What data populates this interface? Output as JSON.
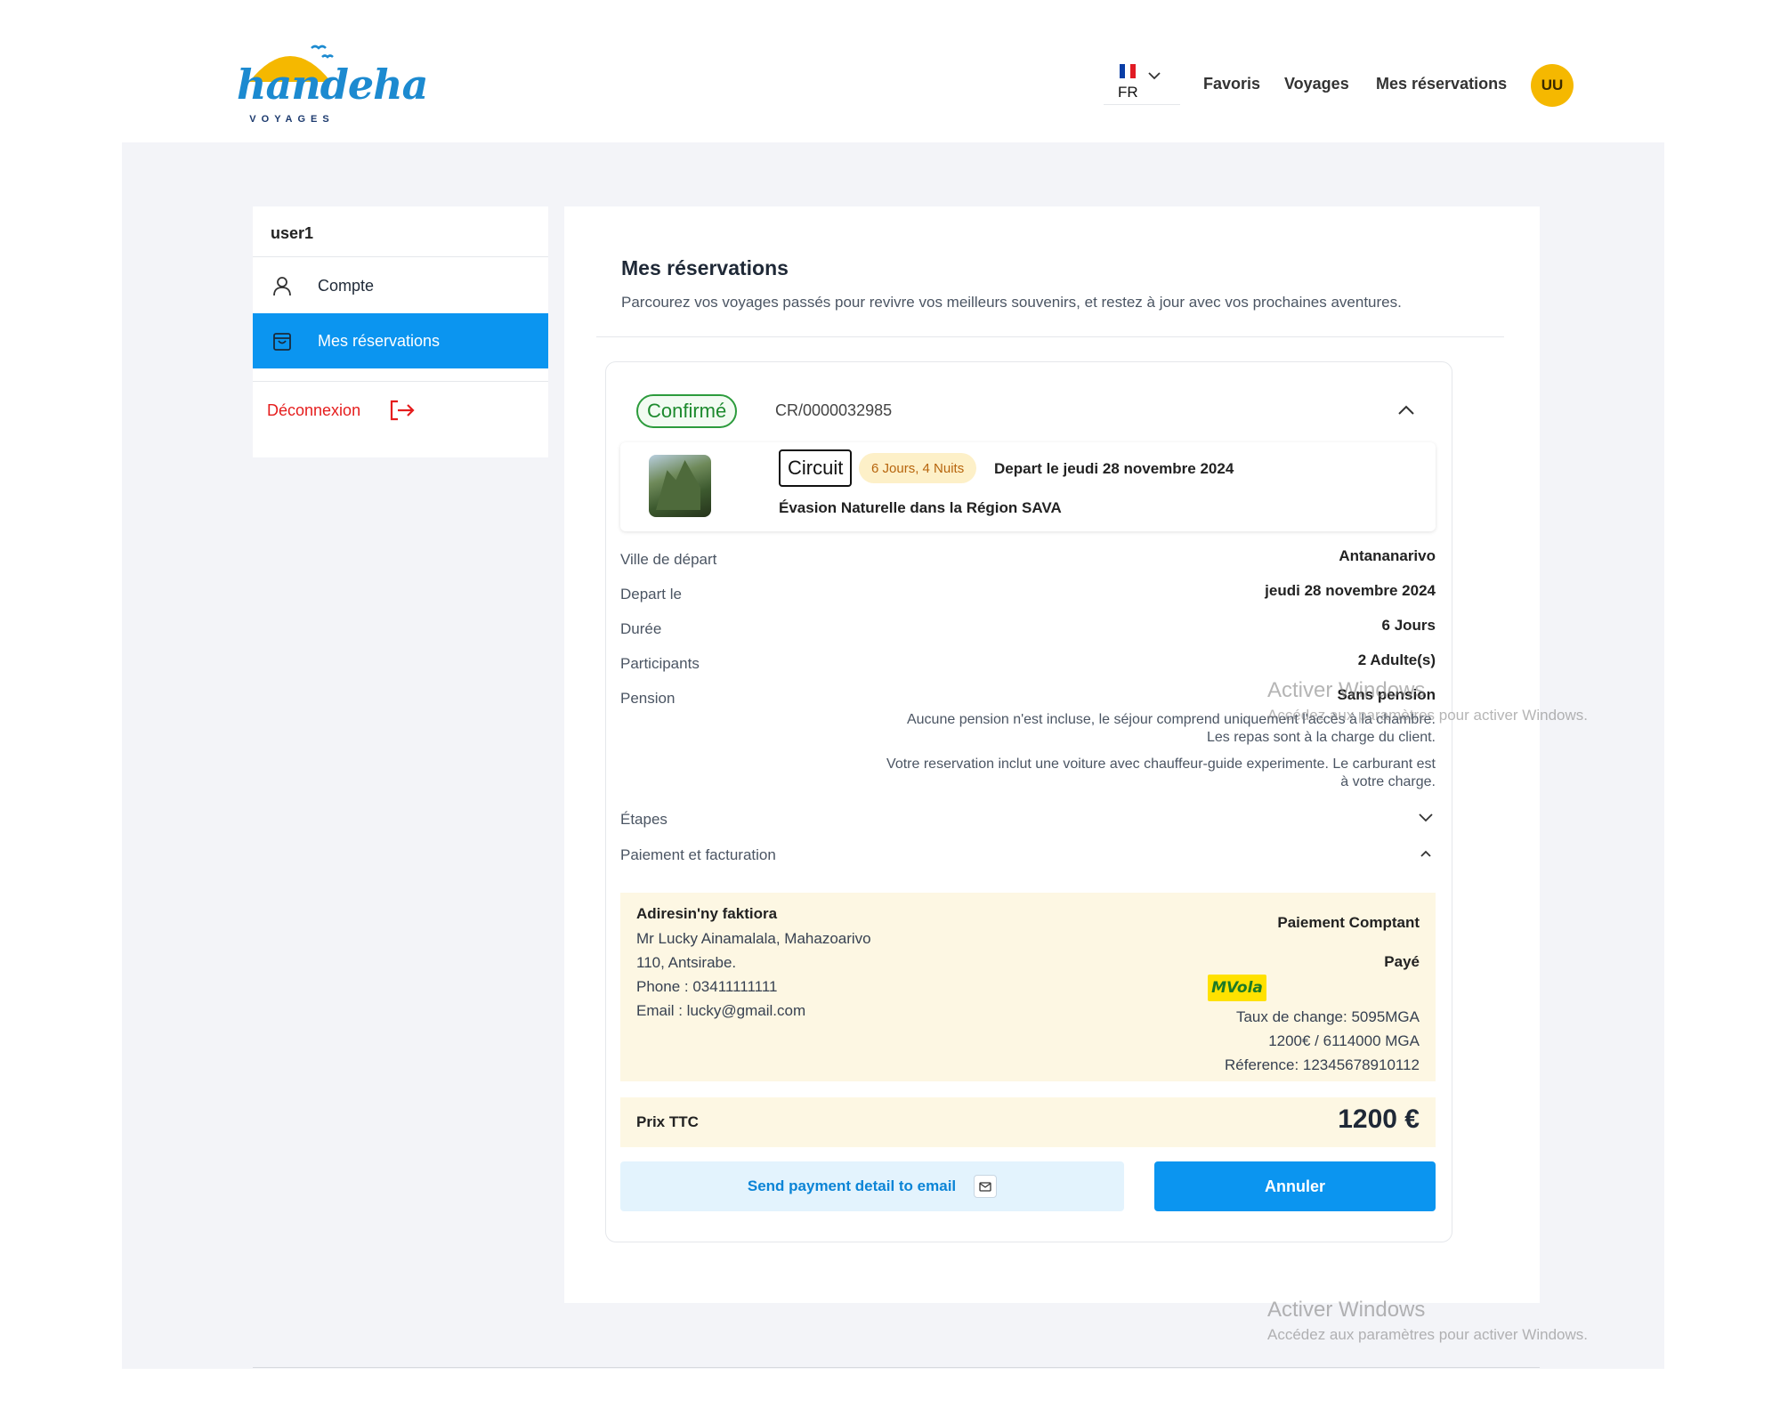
{
  "header": {
    "logo_text": "handeha",
    "logo_sub": "VOYAGES",
    "lang_code": "FR",
    "nav": [
      "Favoris",
      "Voyages",
      "Mes réservations"
    ],
    "avatar_initials": "UU"
  },
  "sidebar": {
    "username": "user1",
    "items": [
      {
        "label": "Compte",
        "icon": "user-icon"
      },
      {
        "label": "Mes réservations",
        "icon": "bag-icon"
      }
    ],
    "logout_label": "Déconnexion"
  },
  "main": {
    "title": "Mes réservations",
    "subtitle": "Parcourez vos voyages passés pour revivre vos meilleurs souvenirs, et restez à jour avec vos prochaines aventures."
  },
  "reservation": {
    "status": "Confirmé",
    "reference": "CR/0000032985",
    "type_tag": "Circuit",
    "duration_tag": "6 Jours, 4 Nuits",
    "depart_heading": "Depart le jeudi 28 novembre 2024",
    "trip_name": "Évasion Naturelle dans la Région SAVA",
    "details": [
      {
        "label": "Ville de départ",
        "value": "Antananarivo"
      },
      {
        "label": "Depart le",
        "value": "jeudi 28 novembre 2024"
      },
      {
        "label": "Durée",
        "value": "6 Jours"
      },
      {
        "label": "Participants",
        "value": "2 Adulte(s)"
      },
      {
        "label": "Pension",
        "value": "Sans pension"
      }
    ],
    "pension_note": [
      "Aucune pension n'est incluse, le séjour comprend uniquement l'accès à la chambre.",
      "Les repas sont à la charge du client."
    ],
    "car_note": [
      "Votre reservation inclut une voiture avec chauffeur-guide experimente. Le carburant est",
      "à votre charge."
    ],
    "sections": {
      "steps": "Étapes",
      "payment": "Paiement et facturation"
    },
    "billing": {
      "title": "Adiresin'ny faktiora",
      "lines": [
        "Mr Lucky Ainamalala, Mahazoarivo",
        "110, Antsirabe.",
        "Phone : 03411111111",
        "Email : lucky@gmail.com"
      ],
      "payment_method": "Paiement Comptant",
      "payment_status": "Payé",
      "provider_logo_text": "MVola",
      "exchange_rate": "Taux de change: 5095MGA",
      "amount_conversion": "1200€ / 6114000 MGA",
      "payment_reference": "Réference: 12345678910112"
    },
    "price_label": "Prix TTC",
    "price_value": "1200 €",
    "email_button": "Send payment detail to email",
    "cancel_button": "Annuler"
  },
  "watermark": {
    "title": "Activer Windows",
    "text": "Accédez aux paramètres pour activer Windows."
  },
  "colors": {
    "primary": "#0b95f0",
    "accent_yellow": "#f5b800",
    "confirmed_green": "#2c9b3c",
    "logout_red": "#e51d1d",
    "billing_bg": "#fdf7e3"
  }
}
